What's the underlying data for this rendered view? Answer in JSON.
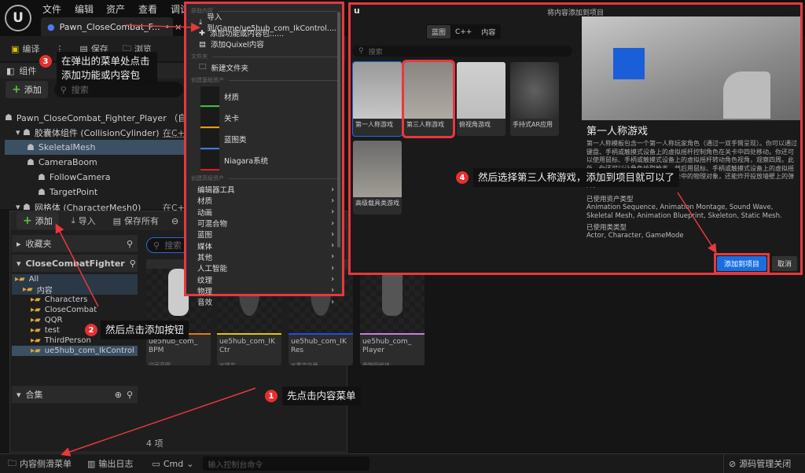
{
  "topbar": {
    "logo": "U",
    "menus": [
      "文件",
      "编辑",
      "资产",
      "查看",
      "调试"
    ],
    "tab": "Pawn_CloseCombat_F...",
    "tab_modified": "•",
    "tab_close": "×"
  },
  "toolbar": {
    "compile": "编译",
    "more": "⋮",
    "save": "保存",
    "browse": "浏览"
  },
  "components": {
    "title": "组件",
    "add": "添加",
    "search_placeholder": "搜索",
    "tree": [
      {
        "label": "Pawn_CloseCombat_Fighter_Player （自我）",
        "indent": 0
      },
      {
        "label": "胶囊体组件 (CollisionCylinder)",
        "indent": 1,
        "cpp": "在C++"
      },
      {
        "label": "SkeletalMesh",
        "indent": 2,
        "selected": true
      },
      {
        "label": "CameraBoom",
        "indent": 2
      },
      {
        "label": "FollowCamera",
        "indent": 3
      },
      {
        "label": "TargetPoint",
        "indent": 3
      },
      {
        "label": "网格体 (CharacterMesh0)",
        "indent": 1,
        "cpp": "在C++"
      }
    ]
  },
  "content_browser": {
    "add": "添加",
    "import": "导入",
    "save_all": "保存所有",
    "favorites": "收藏夹",
    "project": "CloseCombatFighter",
    "folders": [
      {
        "label": "All",
        "indent": 0
      },
      {
        "label": "内容",
        "indent": 1
      },
      {
        "label": "Characters",
        "indent": 2
      },
      {
        "label": "CloseCombat",
        "indent": 2
      },
      {
        "label": "QQR",
        "indent": 2
      },
      {
        "label": "test",
        "indent": 2
      },
      {
        "label": "ThirdPerson",
        "indent": 2
      },
      {
        "label": "ue5hub_com_IkControl",
        "indent": 2,
        "selected": true
      }
    ],
    "collections": "合集",
    "search_placeholder": "搜索",
    "assets": [
      {
        "name": "ue5hub_com_ BPM",
        "type": "动画蓝图",
        "color": "#e07a1f"
      },
      {
        "name": "ue5hub_com_IK Ctr",
        "type": "IK绑定",
        "color": "#e8c400"
      },
      {
        "name": "ue5hub_com_IK Res",
        "type": "IK重定向器",
        "color": "#1f4fe0"
      },
      {
        "name": "ue5hub_com_ Player",
        "type": "骨骼网格体",
        "color": "#c77ee0"
      }
    ],
    "count": "4 项"
  },
  "dropdown": {
    "sec_get": "获取内容",
    "import": "导入到/Game/ue5hub_com_IkControl......",
    "add_feature": "添加功能或内容包......",
    "add_quixel": "添加Quixel内容",
    "sec_folder": "文件夹",
    "new_folder": "新建文件夹",
    "sec_basic": "创建基础资产",
    "basic": [
      {
        "label": "材质",
        "color": "#3cbf3c"
      },
      {
        "label": "关卡",
        "color": "#e89a10"
      },
      {
        "label": "蓝图类",
        "color": "#3a7ae0"
      },
      {
        "label": "Niagara系统",
        "color": "#e02020"
      }
    ],
    "sec_adv": "创建高级资产",
    "advanced": [
      "编辑器工具",
      "材质",
      "动画",
      "可混合物",
      "蓝图",
      "媒体",
      "其他",
      "人工智能",
      "纹理",
      "物理",
      "音效"
    ]
  },
  "dialog": {
    "title": "将内容添加到项目",
    "tabs": [
      "蓝图",
      "C++",
      "内容"
    ],
    "search_placeholder": "搜索",
    "templates": [
      "第一人称游戏",
      "第三人称游戏",
      "俯视角游戏",
      "手持式AR应用",
      "高级载具类游戏"
    ],
    "detail_title": "第一人称游戏",
    "detail_desc": "第一人称模板包含一个第一人称玩家角色（通过一双手臂呈现）。你可以通过键盘、手柄或触摸式设备上的虚拟摇杆控制角色在关卡中四处移动。你还可以使用鼠标、手柄或触摸式设备上的虚拟摇杆转动角色视角，观察四周。此外，你还可以让角色拾取枪支，然后用鼠标、手柄或触摸式设备上的虚拟摇杆发射球形子弹。子弹会撞飞关卡中的物理对象，还能炸开投放墙壁上的弹片。",
    "asset_types_label": "已使用资产类型",
    "asset_types": "Animation Sequence, Animation Montage, Sound Wave, Skeletal Mesh, Animation Blueprint, Skeleton, Static Mesh.",
    "class_types_label": "已使用类类型",
    "class_types": "Actor, Character, GameMode",
    "add": "添加到项目",
    "cancel": "取消"
  },
  "statusbar": {
    "drawer": "内容侧滑菜单",
    "output": "输出日志",
    "cmd": "Cmd",
    "cmd_placeholder": "输入控制台命令",
    "source": "源码管理关闭"
  },
  "callouts": [
    {
      "num": "1",
      "text": "先点击内容菜单"
    },
    {
      "num": "2",
      "text": "然后点击添加按钮"
    },
    {
      "num": "3",
      "text": "在弹出的菜单处点击添加功能或内容包"
    },
    {
      "num": "4",
      "text": "然后选择第三人称游戏，添加到项目就可以了"
    }
  ],
  "colors": {
    "highlight": "#e8383d",
    "accent": "#1a6fe0",
    "selected": "#3c5064"
  }
}
